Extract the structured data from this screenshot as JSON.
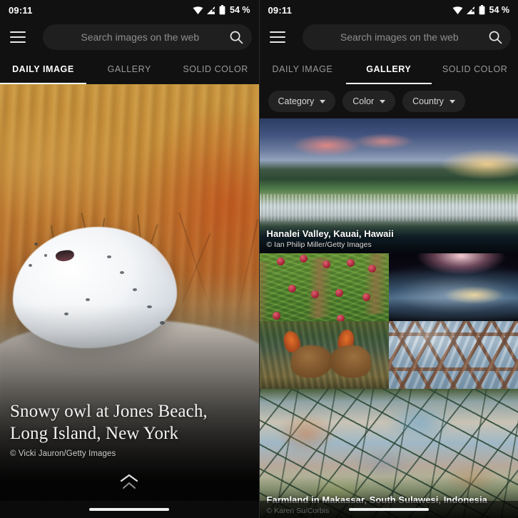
{
  "status_bar": {
    "time": "09:11",
    "battery_percent": "54 %",
    "icons": [
      "wifi-icon",
      "cellular-no-sim-icon",
      "battery-icon"
    ]
  },
  "search": {
    "menu_icon": "hamburger-menu-icon",
    "placeholder": "Search images on the web",
    "search_icon": "search-icon"
  },
  "tabs": [
    {
      "label": "DAILY IMAGE"
    },
    {
      "label": "GALLERY"
    },
    {
      "label": "SOLID COLOR"
    }
  ],
  "left_panel": {
    "active_tab": "DAILY IMAGE",
    "daily_image": {
      "title": "Snowy owl at Jones Beach,\nLong Island, New York",
      "credit": "©  Vicki Jauron/Getty Images",
      "expand_icon": "double-chevron-up-icon"
    }
  },
  "right_panel": {
    "active_tab": "GALLERY",
    "filters": [
      {
        "label": "Category"
      },
      {
        "label": "Color"
      },
      {
        "label": "Country"
      }
    ],
    "gallery_items": [
      {
        "title": "Hanalei Valley, Kauai, Hawaii",
        "credit": "©  Ian Philip Miller/Getty Images",
        "alt": "rice paddies at sunset with mountains"
      },
      {
        "title": "",
        "credit": "",
        "alt": "larch branch with red cones"
      },
      {
        "title": "",
        "credit": "",
        "alt": "earth horizon from space at sunrise"
      },
      {
        "title": "",
        "credit": "",
        "alt": "two nyala antelope facing each other"
      },
      {
        "title": "",
        "credit": "",
        "alt": "triangular glass roof lattice"
      },
      {
        "title": "Farmland in Makassar, South Sulawesi, Indonesia",
        "credit": "© Karen Su/Corbis",
        "alt": "aerial view of colourful rice fields"
      }
    ]
  },
  "nav_bar": {
    "handle": "home-gesture-pill"
  },
  "colors": {
    "background": "#0d0d0d",
    "chrome": "#111111",
    "accent": "#ffffff",
    "chip": "#232323",
    "search_field": "#1f1f1f",
    "text_muted": "#9a9a9a"
  }
}
